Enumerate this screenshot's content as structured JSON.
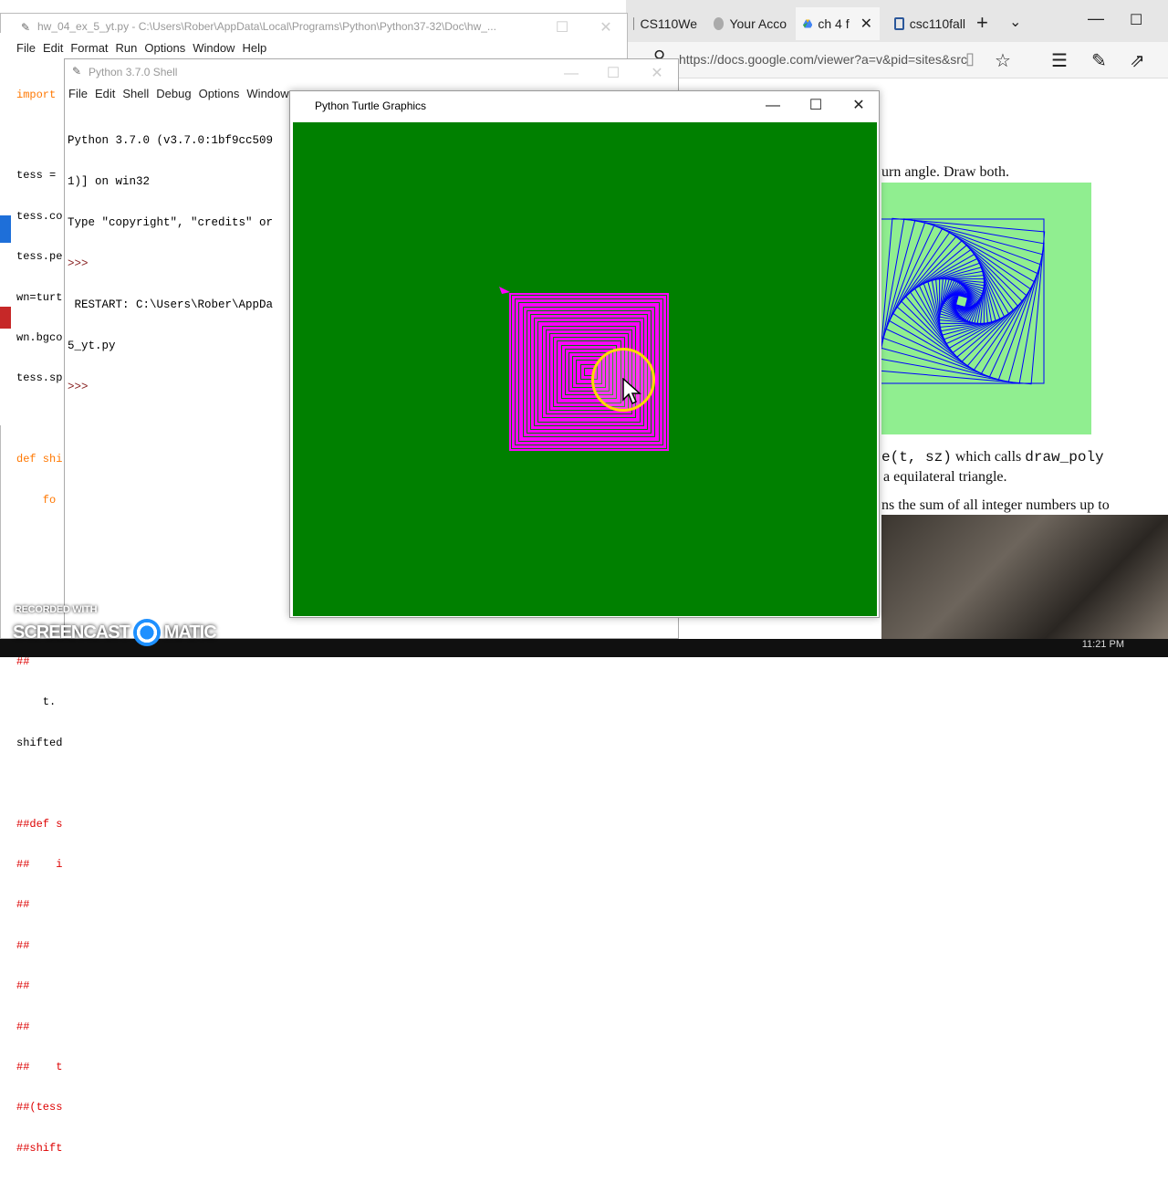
{
  "browser": {
    "tabs": [
      {
        "label": "CS110We",
        "icon": "page-icon"
      },
      {
        "label": "Your Acco",
        "icon": "account-icon"
      },
      {
        "label": "ch 4 f",
        "icon": "drive-icon"
      },
      {
        "label": "csc110fall",
        "icon": "page-icon"
      }
    ],
    "url": "https://docs.google.com/viewer?a=v&pid=sites&src",
    "doc": {
      "line1": "urn angle. Draw both.",
      "line2_code1": "e(t, sz)",
      "line2_mid": " which calls ",
      "line2_code2": "draw_poly",
      "line3": "a equilateral triangle.",
      "line4": "ns the sum of all integer numbers up to"
    },
    "colors": {
      "figure_bg": "#90ee90",
      "figure_lines": "#0000ff"
    }
  },
  "editor": {
    "title": "hw_04_ex_5_yt.py - C:\\Users\\Rober\\AppData\\Local\\Programs\\Python\\Python37-32\\Doc\\hw_...",
    "menu": [
      "File",
      "Edit",
      "Format",
      "Run",
      "Options",
      "Window",
      "Help"
    ],
    "code": {
      "l1": "import",
      "l2": "tess =",
      "l3": "tess.co",
      "l4": "tess.pe",
      "l5": "wn=turt",
      "l6": "wn.bgco",
      "l7": "tess.sp",
      "l8": "def shi",
      "l9": "    fo",
      "l10": "##",
      "l11": "    t.",
      "l12": "shifted",
      "l13": "##def s",
      "l14": "##    i",
      "l15": "##",
      "l16": "##",
      "l17": "##",
      "l18": "##",
      "l19": "##    t",
      "l20": "##(tess",
      "l21": "##shift"
    }
  },
  "shell": {
    "title": "Python 3.7.0 Shell",
    "menu": [
      "File",
      "Edit",
      "Shell",
      "Debug",
      "Options",
      "Window"
    ],
    "output": {
      "o1": "Python 3.7.0 (v3.7.0:1bf9cc509",
      "o2": "1)] on win32",
      "o3": "Type \"copyright\", \"credits\" or",
      "o4": ">>>",
      "o5": " RESTART: C:\\Users\\Rober\\AppDa",
      "o6": "5_yt.py",
      "o7": ">>>"
    }
  },
  "turtle": {
    "title": "Python Turtle Graphics",
    "canvas_color": "#008000",
    "pen_color": "#ff00ff"
  },
  "watermark": {
    "small": "RECORDED WITH",
    "big_left": "SCREENCAST",
    "big_right": "MATIC"
  },
  "taskbar": {
    "clock": "11:21 PM"
  }
}
